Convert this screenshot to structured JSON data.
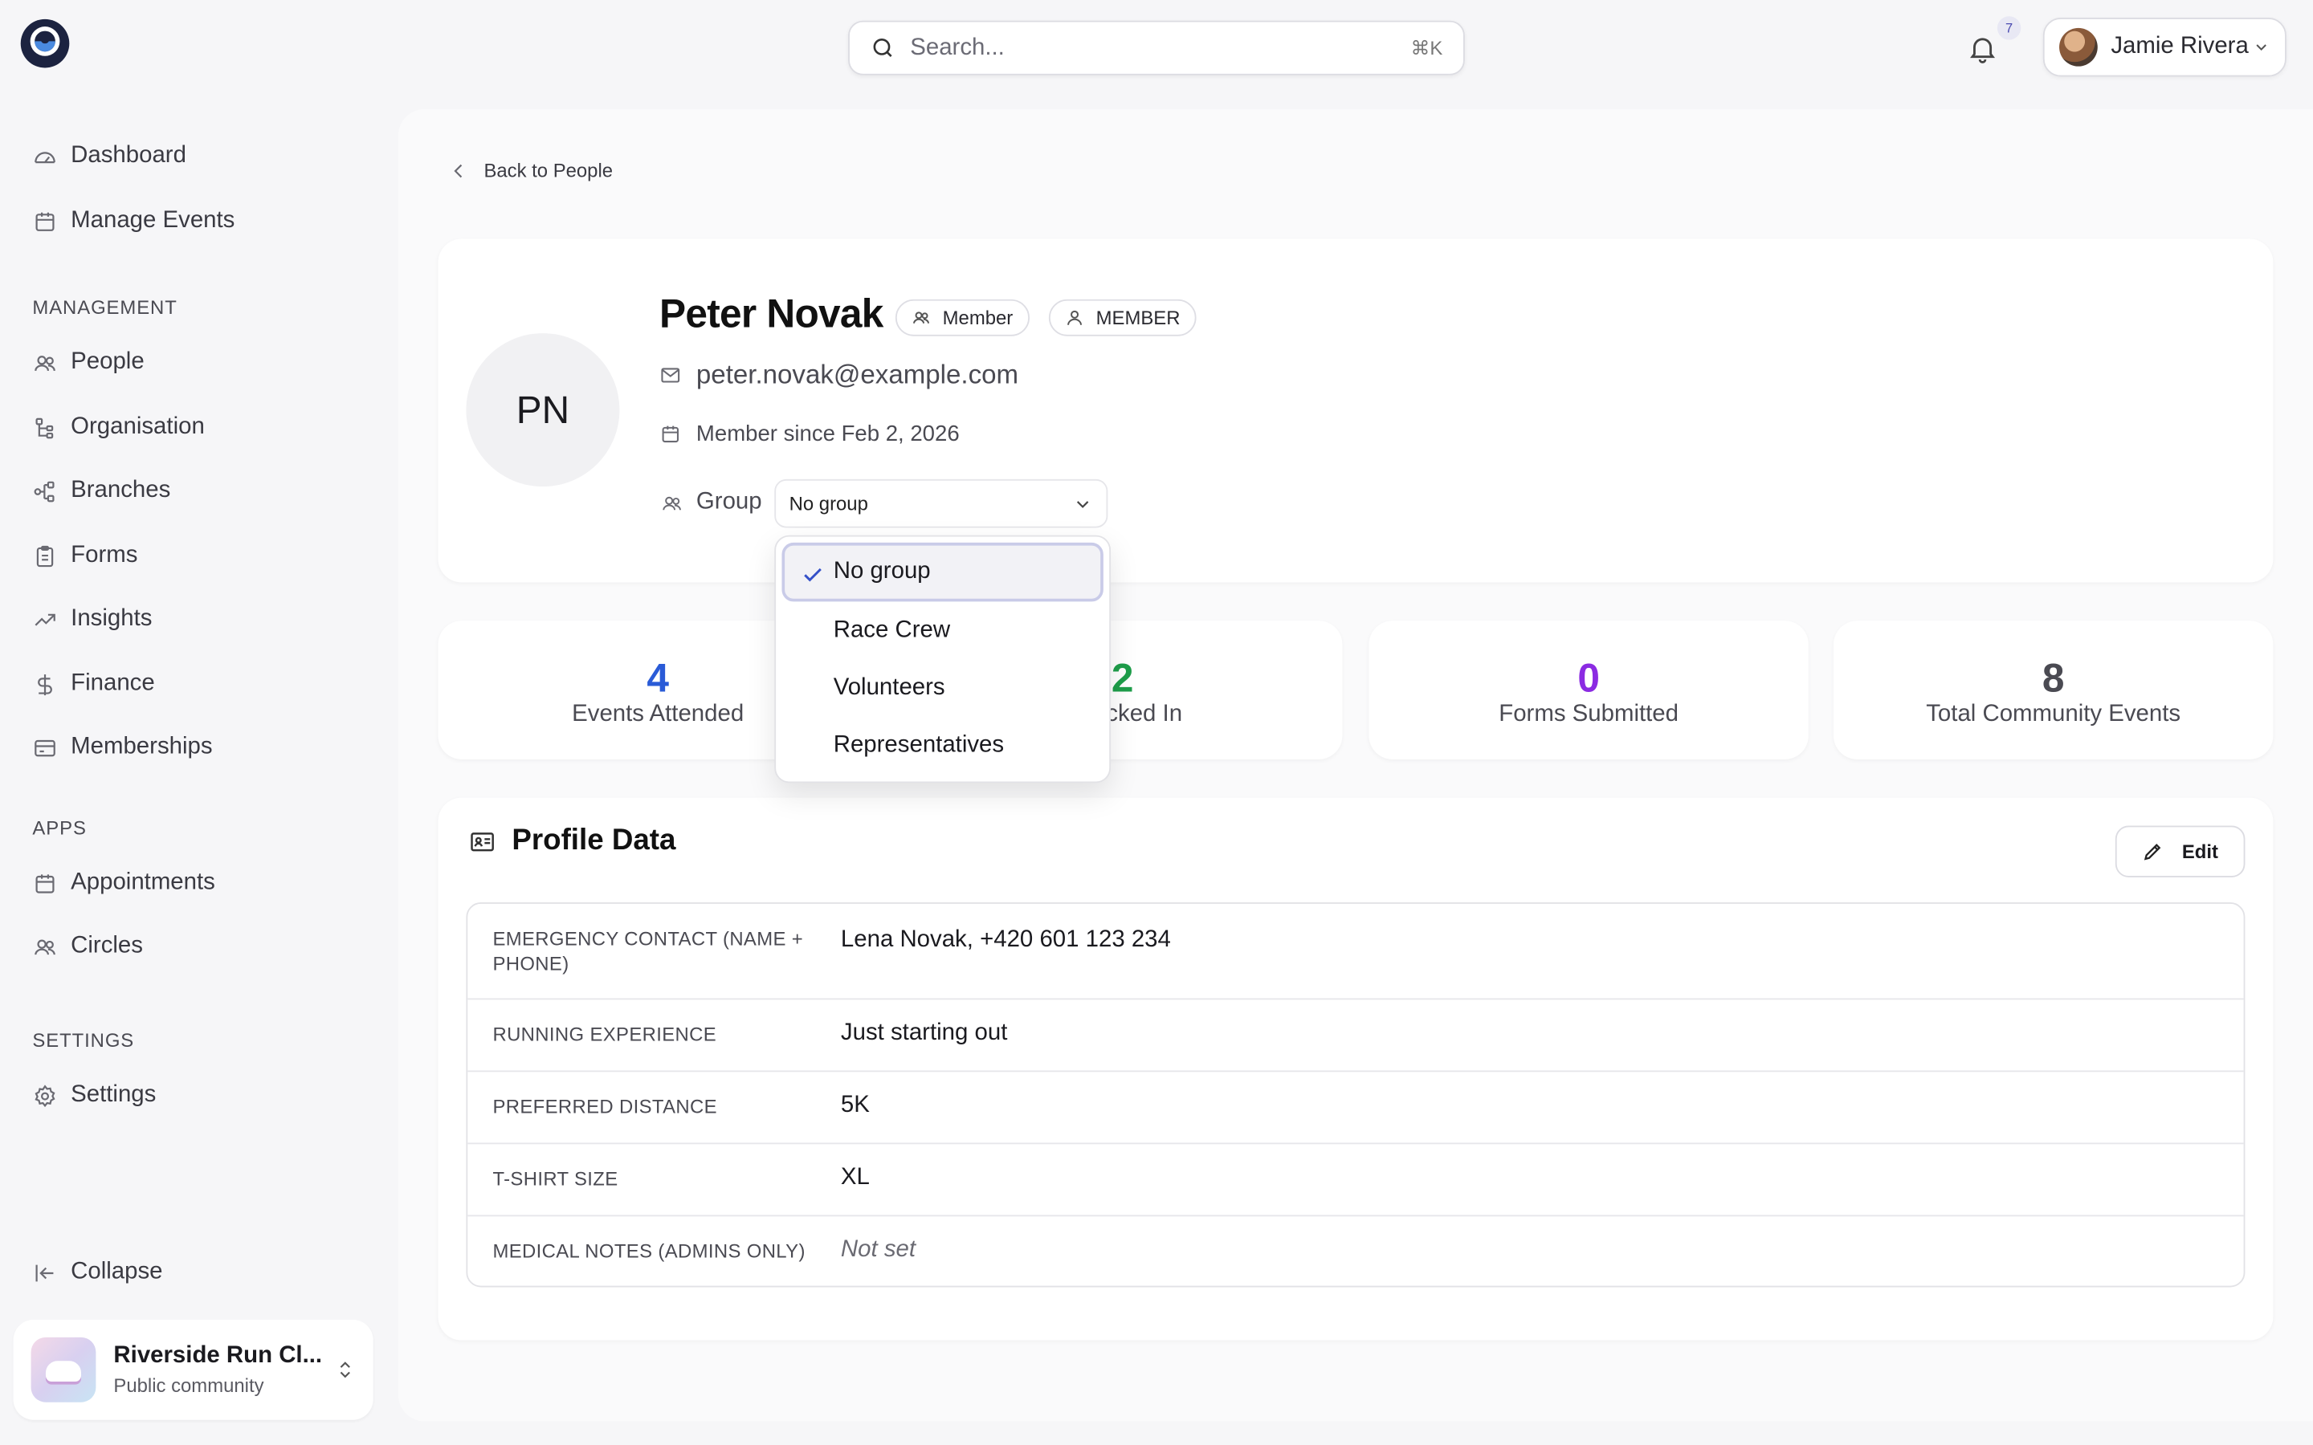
{
  "header": {
    "search_placeholder": "Search...",
    "search_shortcut": "⌘K",
    "notification_count": "7",
    "user_name": "Jamie Rivera"
  },
  "sidebar": {
    "top_items": [
      {
        "label": "Dashboard",
        "icon": "gauge-icon"
      },
      {
        "label": "Manage Events",
        "icon": "calendar-icon"
      }
    ],
    "management_label": "MANAGEMENT",
    "management_items": [
      {
        "label": "People",
        "icon": "people-icon"
      },
      {
        "label": "Organisation",
        "icon": "hierarchy-icon"
      },
      {
        "label": "Branches",
        "icon": "branches-icon"
      },
      {
        "label": "Forms",
        "icon": "clipboard-icon"
      },
      {
        "label": "Insights",
        "icon": "trend-icon"
      },
      {
        "label": "Finance",
        "icon": "dollar-icon"
      },
      {
        "label": "Memberships",
        "icon": "card-icon"
      }
    ],
    "apps_label": "APPS",
    "apps_items": [
      {
        "label": "Appointments",
        "icon": "calendar-icon"
      },
      {
        "label": "Circles",
        "icon": "people-icon"
      }
    ],
    "settings_label": "SETTINGS",
    "settings_items": [
      {
        "label": "Settings",
        "icon": "gear-icon"
      }
    ],
    "collapse_label": "Collapse",
    "community": {
      "name": "Riverside Run Cl...",
      "subtitle": "Public community"
    }
  },
  "main": {
    "back_label": "Back to People",
    "profile": {
      "initials": "PN",
      "name": "Peter Novak",
      "tag_member": "Member",
      "tag_role": "MEMBER",
      "email": "peter.novak@example.com",
      "member_since": "Member since Feb 2, 2026",
      "group_label": "Group",
      "group_value": "No group"
    },
    "group_dropdown": {
      "options": [
        "No group",
        "Race Crew",
        "Volunteers",
        "Representatives"
      ],
      "selected": "No group"
    },
    "stats": [
      {
        "value": "4",
        "label": "Events Attended",
        "color": "#2a5bd7"
      },
      {
        "value": "2",
        "label": "Checked In",
        "color": "#1e9e4a"
      },
      {
        "value": "0",
        "label": "Forms Submitted",
        "color": "#8b2be2"
      },
      {
        "value": "8",
        "label": "Total Community Events",
        "color": "#4a4a52"
      }
    ],
    "profile_data": {
      "title": "Profile Data",
      "edit_label": "Edit",
      "rows": [
        {
          "key": "EMERGENCY CONTACT (NAME + PHONE)",
          "value": "Lena Novak, +420 601 123 234"
        },
        {
          "key": "RUNNING EXPERIENCE",
          "value": "Just starting out"
        },
        {
          "key": "PREFERRED DISTANCE",
          "value": "5K"
        },
        {
          "key": "T-SHIRT SIZE",
          "value": "XL"
        },
        {
          "key": "MEDICAL NOTES (ADMINS ONLY)",
          "value": "Not set"
        }
      ]
    }
  }
}
